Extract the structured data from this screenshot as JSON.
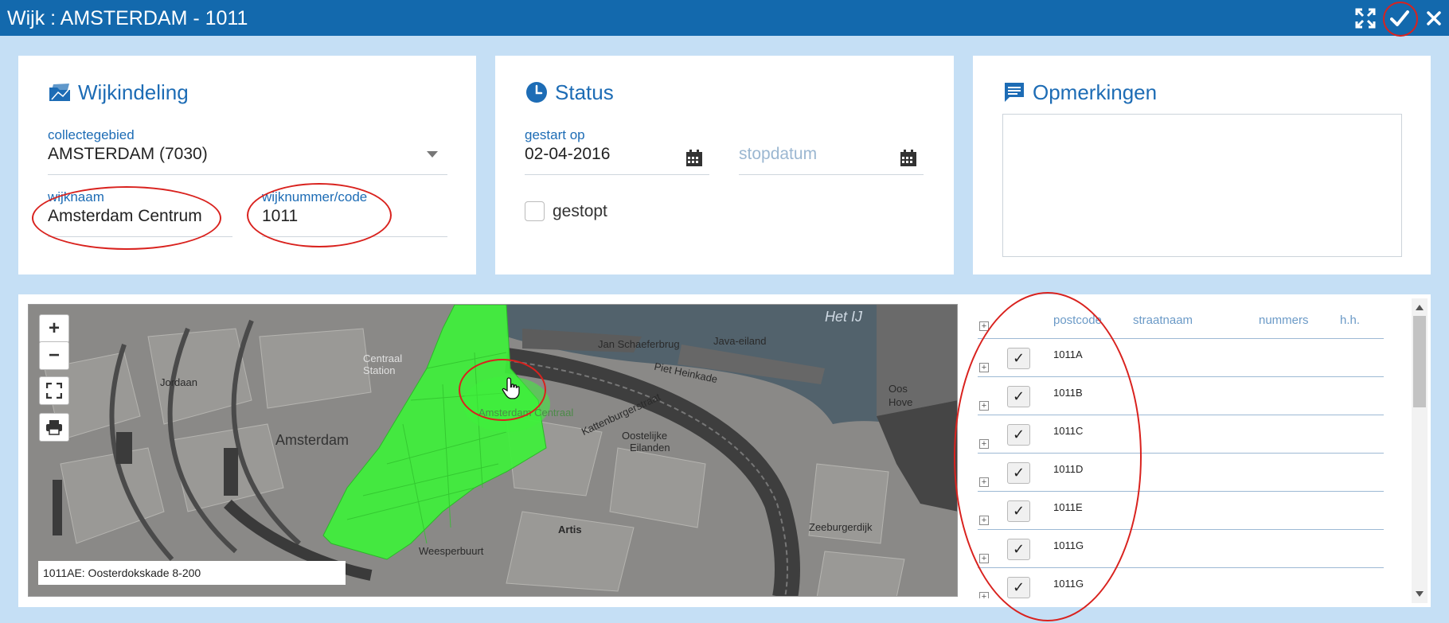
{
  "window": {
    "title": "Wijk : AMSTERDAM - 1011",
    "icons": [
      "expand-icon",
      "check-icon",
      "close-icon"
    ]
  },
  "wijkindeling": {
    "heading": "Wijkindeling",
    "icon": "map-folder-icon",
    "collectegebied_label": "collectegebied",
    "collectegebied_value": "AMSTERDAM (7030)",
    "wijknaam_label": "wijknaam",
    "wijknaam_value": "Amsterdam Centrum",
    "wijknummer_label": "wijknummer/code",
    "wijknummer_value": "1011"
  },
  "status": {
    "heading": "Status",
    "icon": "clock-icon",
    "gestart_label": "gestart op",
    "gestart_value": "02-04-2016",
    "stopdatum_placeholder": "stopdatum",
    "gestopt_label": "gestopt",
    "gestopt_checked": false
  },
  "opmerkingen": {
    "heading": "Opmerkingen",
    "icon": "comment-icon",
    "value": ""
  },
  "map": {
    "zoom_in": "+",
    "zoom_out": "−",
    "status_text": "1011AE: Oosterdokskade 8-200",
    "labels": {
      "het_ij": "Het IJ",
      "amsterdam": "Amsterdam",
      "jordaan": "Jordaan",
      "jan_schaefer": "Jan Schaeferbrug",
      "piet_hein": "Piet Heinkade",
      "oostelijke": "Oostelijke",
      "eilanden": "Eilanden",
      "artis": "Artis",
      "weesperbuurt": "Weesperbuurt",
      "centrum": "Amsterdam Centraal",
      "centraal_station": "Centraal Station",
      "kattenburg": "Kattenburgerstraat",
      "java": "Java-eiland",
      "oos": "Oos",
      "hove": "Hove",
      "zeeburgerdijk": "Zeeburgerdijk"
    },
    "highlight_color": "#3ef03a"
  },
  "table": {
    "headers": {
      "postcode": "postcode",
      "straatnaam": "straatnaam",
      "nummers": "nummers",
      "hh": "h.h."
    },
    "rows": [
      {
        "postcode": "1011A",
        "checked": "✓"
      },
      {
        "postcode": "1011B",
        "checked": "✓"
      },
      {
        "postcode": "1011C",
        "checked": "✓"
      },
      {
        "postcode": "1011D",
        "checked": "✓"
      },
      {
        "postcode": "1011E",
        "checked": "✓"
      },
      {
        "postcode": "1011G",
        "checked": "✓"
      },
      {
        "postcode": "1011G",
        "checked": "✓"
      }
    ]
  },
  "colors": {
    "titlebar": "#1369ad",
    "accent": "#1d6cb5",
    "background": "#c5dff5",
    "annotation": "#d9221e"
  }
}
